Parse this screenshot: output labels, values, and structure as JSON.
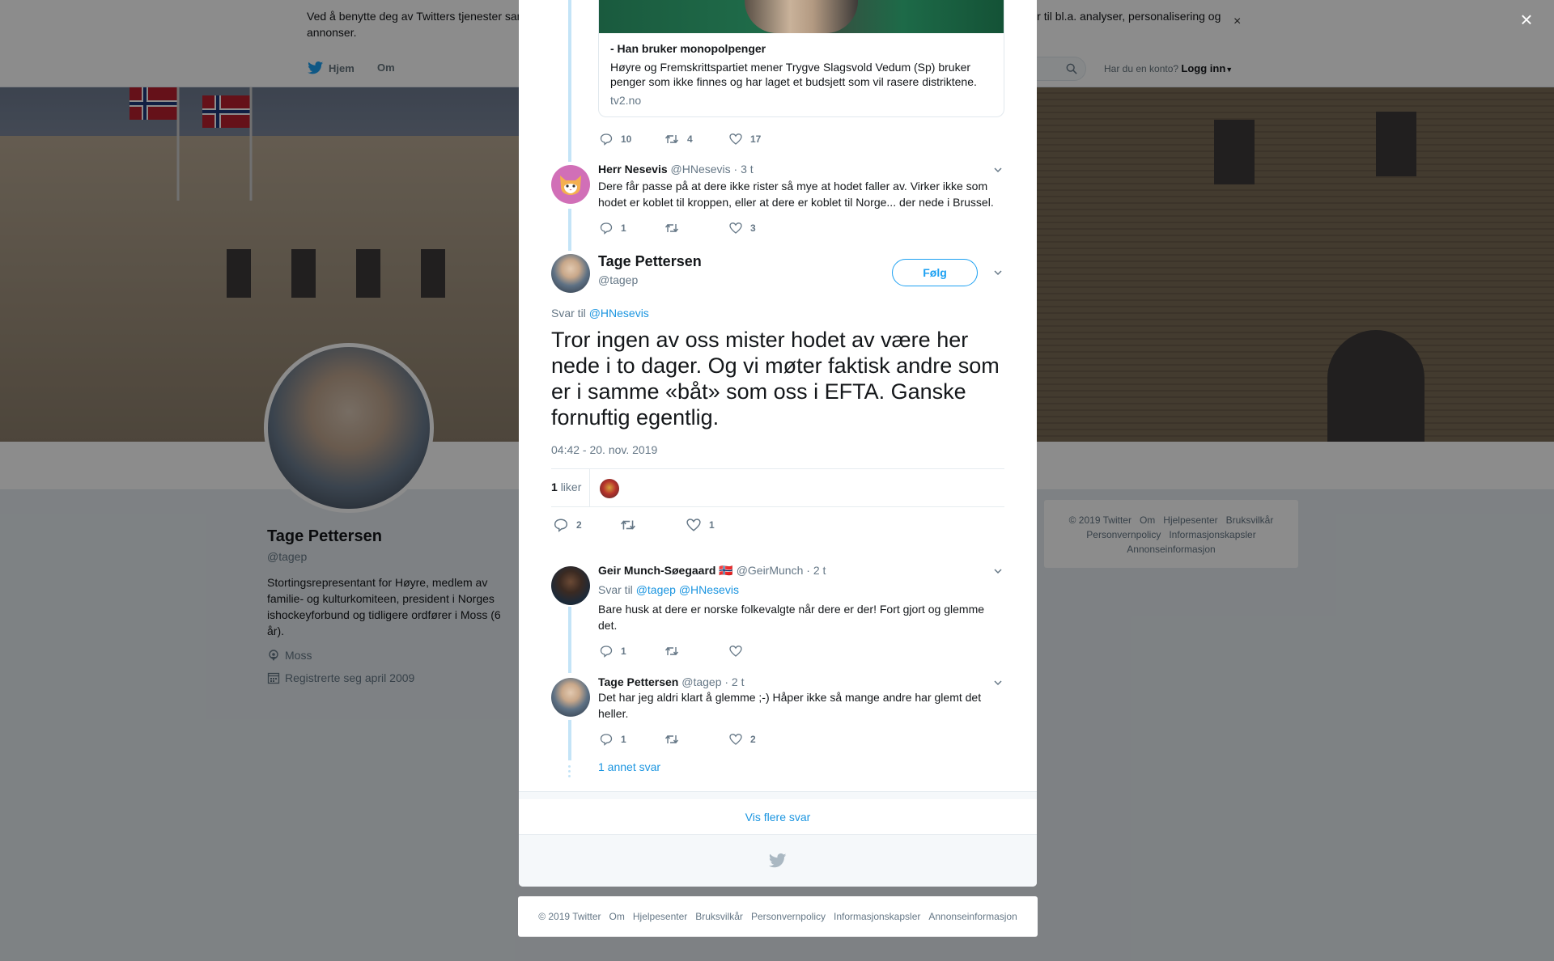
{
  "cookie_bar": {
    "text": "Ved å benytte deg av Twitters tjenester samtykker du i vår bruk av informasjonskapsler. Vi og våre samarbeidspartnere bruker informasjonskapsler til bl.a. analyser, personalisering og annonser.",
    "close": "×"
  },
  "nav": {
    "home": "Hjem",
    "about": "Om",
    "account_prompt": "Har du en konto?",
    "login": "Logg inn"
  },
  "profile": {
    "name": "Tage Pettersen",
    "handle": "@tagep",
    "bio": "Stortingsrepresentant for Høyre, medlem av familie- og kulturkomiteen, president i Norges ishockeyforbund og tidligere ordfører i Moss (6 år).",
    "location": "Moss",
    "joined": "Registrerte seg april 2009"
  },
  "right_footer": {
    "links_row1": [
      "© 2019 Twitter",
      "Om",
      "Hjelpesenter",
      "Bruksvilkår"
    ],
    "links_row2": [
      "Personvernpolicy",
      "Informasjonskapsler"
    ],
    "links_row3": [
      "Annonseinformasjon"
    ]
  },
  "overlay_close": "×",
  "thread": {
    "card": {
      "title": "- Han bruker monopolpenger",
      "description": "Høyre og Fremskrittspartiet mener Trygve Slagsvold Vedum (Sp) bruker penger som ikke finnes og har laget et budsjett som vil rasere distriktene.",
      "domain": "tv2.no"
    },
    "card_actions": {
      "replies": "10",
      "retweets": "4",
      "likes": "17"
    },
    "reply1": {
      "name": "Herr Nesevis",
      "handle": "@HNesevis",
      "time": "· 3 t",
      "text": "Dere får passe på at dere ikke rister så mye at hodet faller av. Virker ikke som hodet er koblet til kroppen, eller at dere er koblet til Norge... der nede i Brussel.",
      "replies": "1",
      "retweets": "",
      "likes": "3"
    },
    "main": {
      "name": "Tage Pettersen",
      "handle": "@tagep",
      "follow": "Følg",
      "reply_to_label": "Svar til",
      "reply_to_handle": "@HNesevis",
      "text": "Tror ingen av oss mister hodet av være her nede i to dager. Og vi møter faktisk andre som er i samme «båt» som oss i EFTA. Ganske fornuftig egentlig.",
      "timestamp": "04:42 - 20. nov. 2019",
      "likes_count": "1",
      "likes_label": "liker",
      "replies": "2",
      "retweets": "",
      "likes": "1"
    },
    "reply2": {
      "name": "Geir Munch-Søegaard",
      "flag": "🇳🇴",
      "handle": "@GeirMunch",
      "time": "· 2 t",
      "reply_to_label": "Svar til",
      "reply_to_handles": "@tagep @HNesevis",
      "text": "Bare husk at dere er norske folkevalgte når dere er der! Fort gjort og glemme det.",
      "replies": "1",
      "retweets": "",
      "likes": ""
    },
    "reply3": {
      "name": "Tage Pettersen",
      "handle": "@tagep",
      "time": "· 2 t",
      "text": "Det har jeg aldri klart å glemme ;-) Håper ikke så mange andre har glemt det heller.",
      "replies": "1",
      "retweets": "",
      "likes": "2"
    },
    "more_replies": "1 annet svar",
    "show_more": "Vis flere svar"
  },
  "bottom_footer": {
    "links": [
      "© 2019 Twitter",
      "Om",
      "Hjelpesenter",
      "Bruksvilkår",
      "Personvernpolicy",
      "Informasjonskapsler",
      "Annonseinformasjon"
    ]
  },
  "colors": {
    "twitter_blue": "#1da1f2",
    "link_blue": "#1b95e0",
    "thread_line": "#c4e4f7",
    "muted_text": "#657786",
    "page_bg": "#e6ecf0"
  }
}
